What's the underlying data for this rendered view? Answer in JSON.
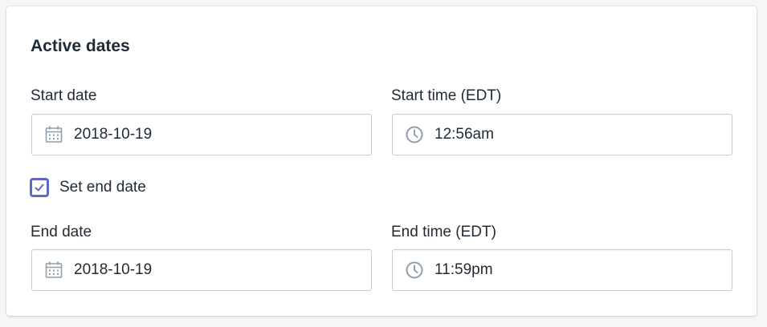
{
  "card": {
    "title": "Active dates"
  },
  "start": {
    "date_label": "Start date",
    "date_value": "2018-10-19",
    "time_label": "Start time (EDT)",
    "time_value": "12:56am"
  },
  "end_toggle": {
    "label": "Set end date",
    "checked": true
  },
  "end": {
    "date_label": "End date",
    "date_value": "2018-10-19",
    "time_label": "End time (EDT)",
    "time_value": "11:59pm"
  },
  "colors": {
    "accent": "#5c6ac4",
    "icon": "#919eab",
    "border": "#c4cdd5",
    "text": "#212b36"
  },
  "icons": {
    "date": "calendar-icon",
    "time": "clock-icon",
    "check": "checkmark-icon"
  }
}
